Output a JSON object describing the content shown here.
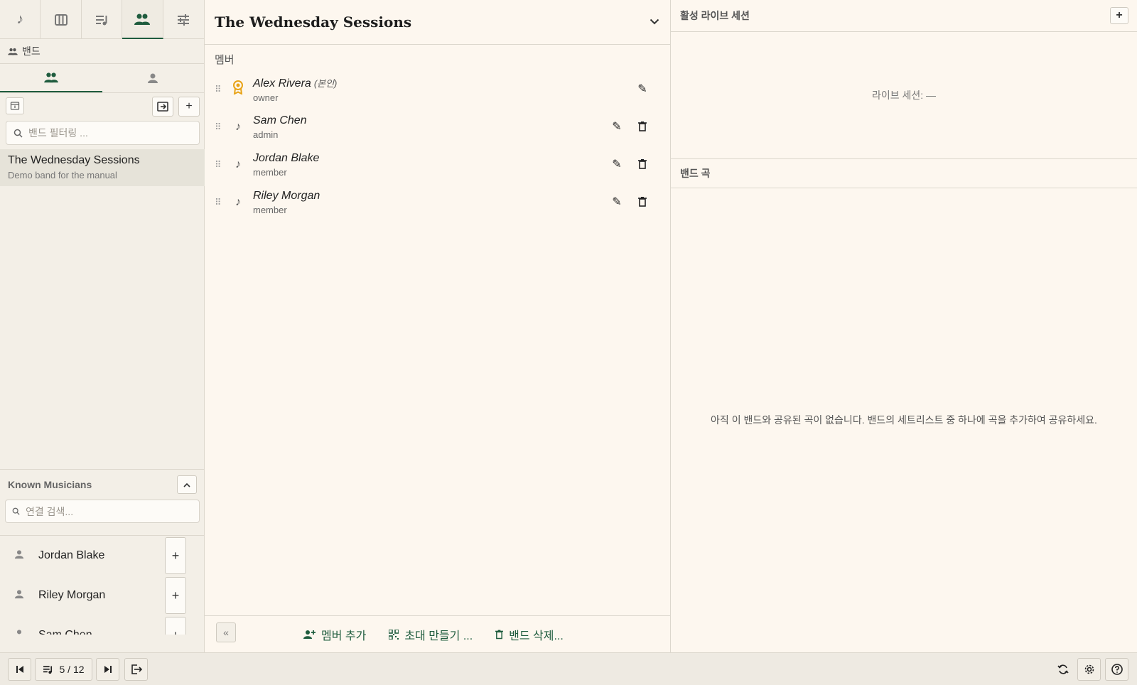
{
  "sidebar": {
    "nav_tabs": [
      {
        "icon": "music-note-icon",
        "glyph": "♪"
      },
      {
        "icon": "piano-icon",
        "glyph": "▥"
      },
      {
        "icon": "playlist-icon",
        "glyph": "≡"
      },
      {
        "icon": "people-icon",
        "glyph": "👥"
      },
      {
        "icon": "sliders-icon",
        "glyph": "☰"
      }
    ],
    "section_title": "밴드",
    "filter_placeholder": "밴드 필터링 ...",
    "band": {
      "name": "The Wednesday Sessions",
      "description": "Demo band for the manual"
    },
    "known_musicians_title": "Known Musicians",
    "connection_search_placeholder": "연결 검색...",
    "musicians": [
      "Jordan Blake",
      "Riley Morgan",
      "Sam Chen"
    ]
  },
  "main": {
    "title": "The Wednesday Sessions",
    "members_label": "멤버",
    "members": [
      {
        "name": "Alex Rivera",
        "self_tag": "(본인)",
        "role": "owner"
      },
      {
        "name": "Sam Chen",
        "self_tag": "",
        "role": "admin"
      },
      {
        "name": "Jordan Blake",
        "self_tag": "",
        "role": "member"
      },
      {
        "name": "Riley Morgan",
        "self_tag": "",
        "role": "member"
      }
    ],
    "footer": {
      "add_member": "멤버 추가",
      "create_invite": "초대 만들기 ...",
      "delete_band": "밴드 삭제..."
    }
  },
  "right": {
    "live_sessions_title": "활성 라이브 세션",
    "live_sessions_text": "라이브 세션: —",
    "band_songs_title": "밴드 곡",
    "band_songs_empty": "아직 이 밴드와 공유된 곡이 없습니다. 밴드의 세트리스트 중 하나에 곡을 추가하여 공유하세요."
  },
  "bottombar": {
    "setlist_position": "5 / 12"
  },
  "colors": {
    "accent": "#1f5c3e",
    "owner_badge": "#e8a317",
    "background": "#fdf7ef",
    "sidebar": "#f3efe7"
  }
}
